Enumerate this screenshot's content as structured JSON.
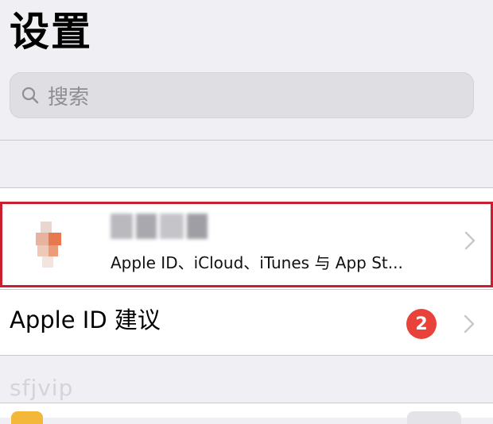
{
  "header": {
    "title": "设置"
  },
  "search": {
    "placeholder": "搜索",
    "icon": "search-icon"
  },
  "profile": {
    "name": "",
    "subtitle": "Apple ID、iCloud、iTunes 与 App St...",
    "highlight_color": "#c8202c"
  },
  "suggestions": {
    "label": "Apple ID 建议",
    "badge_count": "2",
    "badge_color": "#e8423a"
  },
  "watermark": {
    "text": "sfjvip"
  }
}
